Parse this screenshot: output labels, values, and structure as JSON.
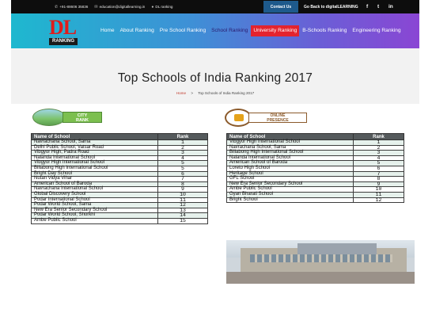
{
  "topbar": {
    "phone": "+91-88606 35836",
    "email": "education@digitallearning.in",
    "ranking_link": "DL ranking",
    "contact_label": "Contact Us",
    "back_label": "Go Back to digitalLEARNING",
    "social": [
      "f",
      "t",
      "in"
    ]
  },
  "brand": {
    "logo_text": "DL",
    "logo_subtext": "RANKING"
  },
  "nav": {
    "items": [
      "Home",
      "About Ranking",
      "Pre School Ranking",
      "School Ranking",
      "University Ranking",
      "B-Schools Ranking",
      "Engineering Ranking"
    ]
  },
  "page": {
    "title": "Top Schools of India Ranking 2017",
    "breadcrumb_home": "Home",
    "breadcrumb_sep": ">",
    "breadcrumb_current": "Top Schools of India Ranking 2017"
  },
  "left_panel": {
    "badge_line1": "CITY",
    "badge_line2": "RANK",
    "col_name": "Name of School",
    "col_rank": "Rank",
    "rows": [
      {
        "name": "Navrachana School, Sama",
        "rank": "1"
      },
      {
        "name": "Delhi Public School, Vatsar Road",
        "rank": "2"
      },
      {
        "name": "Vibgyor High, Padra Road",
        "rank": "3"
      },
      {
        "name": "Nalanda International School",
        "rank": "4"
      },
      {
        "name": "Vibgyor High International School",
        "rank": "5"
      },
      {
        "name": "Billabong High International School",
        "rank": "5"
      },
      {
        "name": "Bright Day School",
        "rank": "6"
      },
      {
        "name": "Nutan Vidya Vihar",
        "rank": "7"
      },
      {
        "name": "American School of Baroda",
        "rank": "8"
      },
      {
        "name": "Navrachana International School",
        "rank": "9"
      },
      {
        "name": "Global Discovery School",
        "rank": "10"
      },
      {
        "name": "Podar International School",
        "rank": "11"
      },
      {
        "name": "Podar World School, Sama",
        "rank": "12"
      },
      {
        "name": "New Era Senior Secondary School",
        "rank": "13"
      },
      {
        "name": "Podar World School, Shorkhi",
        "rank": "14"
      },
      {
        "name": "Ambe Public School",
        "rank": "15"
      }
    ]
  },
  "right_panel": {
    "badge_line1": "ONLINE",
    "badge_line2": "PRESENCE",
    "col_name": "Name of School",
    "col_rank": "Rank",
    "rows": [
      {
        "name": "Vibgyor High International School",
        "rank": "1"
      },
      {
        "name": "Navrachana School, Sama",
        "rank": "2"
      },
      {
        "name": "Billabong High International School",
        "rank": "3"
      },
      {
        "name": "Nalanda International School",
        "rank": "4"
      },
      {
        "name": "American School of Baroda",
        "rank": "5"
      },
      {
        "name": "Loreto High School",
        "rank": "6"
      },
      {
        "name": "Heritage School",
        "rank": "7"
      },
      {
        "name": "GFL School",
        "rank": "8"
      },
      {
        "name": "New Era Senior Secondary School",
        "rank": "9"
      },
      {
        "name": "Ambe Public School",
        "rank": "10"
      },
      {
        "name": "Gyan Bharati School",
        "rank": "11"
      },
      {
        "name": "Bright School",
        "rank": "12"
      }
    ]
  },
  "colors": {
    "nav_gradient_start": "#1eb8cf",
    "nav_gradient_end": "#8a46d4",
    "highlight_red": "#e4232e",
    "contact_blue": "#1e5a8c"
  }
}
